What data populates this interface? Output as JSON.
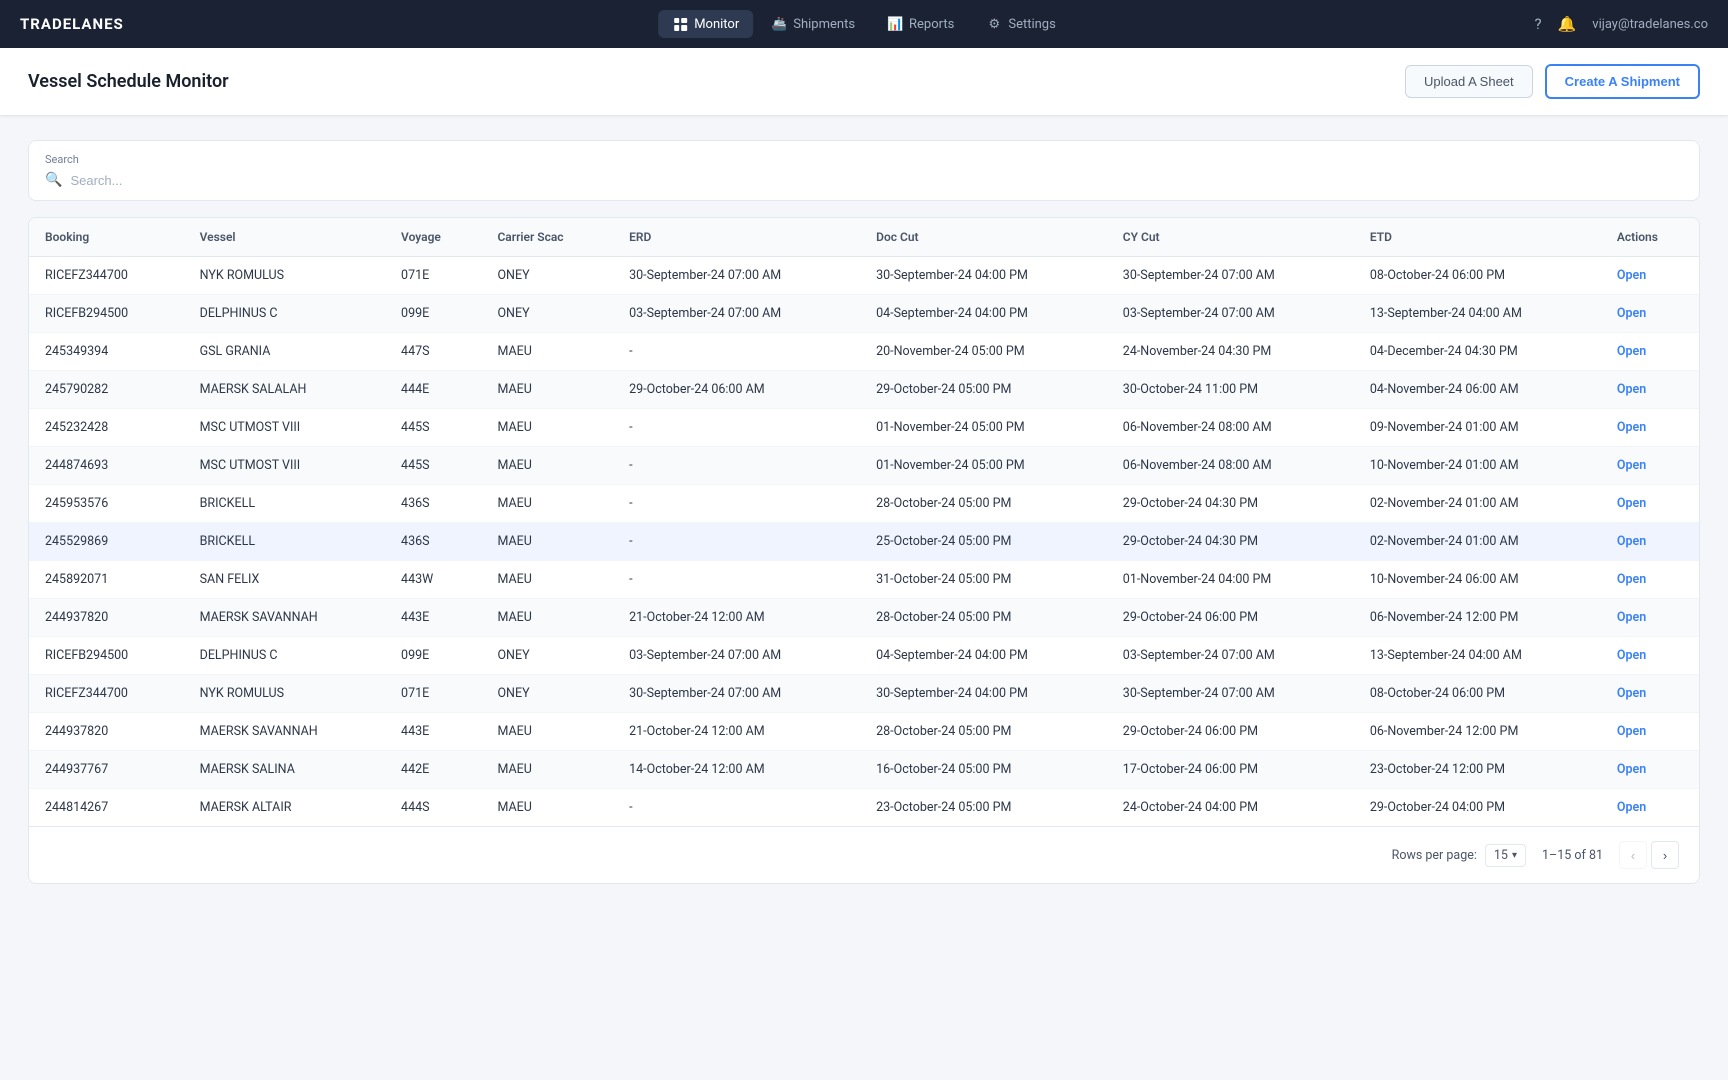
{
  "brand": "TRADELANES",
  "nav": {
    "items": [
      {
        "id": "monitor",
        "label": "Monitor",
        "active": true,
        "icon": "grid"
      },
      {
        "id": "shipments",
        "label": "Shipments",
        "active": false,
        "icon": "truck"
      },
      {
        "id": "reports",
        "label": "Reports",
        "active": false,
        "icon": "chart"
      },
      {
        "id": "settings",
        "label": "Settings",
        "active": false,
        "icon": "gear"
      }
    ],
    "user": "vijay@tradelanes.co"
  },
  "page": {
    "title": "Vessel Schedule Monitor",
    "upload_btn": "Upload A Sheet",
    "create_btn": "Create A Shipment"
  },
  "search": {
    "label": "Search",
    "placeholder": "Search..."
  },
  "table": {
    "columns": [
      "Booking",
      "Vessel",
      "Voyage",
      "Carrier Scac",
      "ERD",
      "Doc Cut",
      "CY Cut",
      "ETD",
      "Actions"
    ],
    "rows": [
      {
        "booking": "RICEFZ344700",
        "vessel": "NYK ROMULUS",
        "voyage": "071E",
        "carrier": "ONEY",
        "erd": "30-September-24 07:00 AM",
        "doc_cut": "30-September-24 04:00 PM",
        "cy_cut": "30-September-24 07:00 AM",
        "etd": "08-October-24 06:00 PM",
        "action": "Open",
        "highlighted": false
      },
      {
        "booking": "RICEFB294500",
        "vessel": "DELPHINUS C",
        "voyage": "099E",
        "carrier": "ONEY",
        "erd": "03-September-24 07:00 AM",
        "doc_cut": "04-September-24 04:00 PM",
        "cy_cut": "03-September-24 07:00 AM",
        "etd": "13-September-24 04:00 AM",
        "action": "Open",
        "highlighted": false
      },
      {
        "booking": "245349394",
        "vessel": "GSL GRANIA",
        "voyage": "447S",
        "carrier": "MAEU",
        "erd": "-",
        "doc_cut": "20-November-24 05:00 PM",
        "cy_cut": "24-November-24 04:30 PM",
        "etd": "04-December-24 04:30 PM",
        "action": "Open",
        "highlighted": false
      },
      {
        "booking": "245790282",
        "vessel": "MAERSK SALALAH",
        "voyage": "444E",
        "carrier": "MAEU",
        "erd": "29-October-24 06:00 AM",
        "doc_cut": "29-October-24 05:00 PM",
        "cy_cut": "30-October-24 11:00 PM",
        "etd": "04-November-24 06:00 AM",
        "action": "Open",
        "highlighted": false
      },
      {
        "booking": "245232428",
        "vessel": "MSC UTMOST VIII",
        "voyage": "445S",
        "carrier": "MAEU",
        "erd": "-",
        "doc_cut": "01-November-24 05:00 PM",
        "cy_cut": "06-November-24 08:00 AM",
        "etd": "09-November-24 01:00 AM",
        "action": "Open",
        "highlighted": false
      },
      {
        "booking": "244874693",
        "vessel": "MSC UTMOST VIII",
        "voyage": "445S",
        "carrier": "MAEU",
        "erd": "-",
        "doc_cut": "01-November-24 05:00 PM",
        "cy_cut": "06-November-24 08:00 AM",
        "etd": "10-November-24 01:00 AM",
        "action": "Open",
        "highlighted": false
      },
      {
        "booking": "245953576",
        "vessel": "BRICKELL",
        "voyage": "436S",
        "carrier": "MAEU",
        "erd": "-",
        "doc_cut": "28-October-24 05:00 PM",
        "cy_cut": "29-October-24 04:30 PM",
        "etd": "02-November-24 01:00 AM",
        "action": "Open",
        "highlighted": false
      },
      {
        "booking": "245529869",
        "vessel": "BRICKELL",
        "voyage": "436S",
        "carrier": "MAEU",
        "erd": "-",
        "doc_cut": "25-October-24 05:00 PM",
        "cy_cut": "29-October-24 04:30 PM",
        "etd": "02-November-24 01:00 AM",
        "action": "Open",
        "highlighted": true
      },
      {
        "booking": "245892071",
        "vessel": "SAN FELIX",
        "voyage": "443W",
        "carrier": "MAEU",
        "erd": "-",
        "doc_cut": "31-October-24 05:00 PM",
        "cy_cut": "01-November-24 04:00 PM",
        "etd": "10-November-24 06:00 AM",
        "action": "Open",
        "highlighted": false
      },
      {
        "booking": "244937820",
        "vessel": "MAERSK SAVANNAH",
        "voyage": "443E",
        "carrier": "MAEU",
        "erd": "21-October-24 12:00 AM",
        "doc_cut": "28-October-24 05:00 PM",
        "cy_cut": "29-October-24 06:00 PM",
        "etd": "06-November-24 12:00 PM",
        "action": "Open",
        "highlighted": false
      },
      {
        "booking": "RICEFB294500",
        "vessel": "DELPHINUS C",
        "voyage": "099E",
        "carrier": "ONEY",
        "erd": "03-September-24 07:00 AM",
        "doc_cut": "04-September-24 04:00 PM",
        "cy_cut": "03-September-24 07:00 AM",
        "etd": "13-September-24 04:00 AM",
        "action": "Open",
        "highlighted": false
      },
      {
        "booking": "RICEFZ344700",
        "vessel": "NYK ROMULUS",
        "voyage": "071E",
        "carrier": "ONEY",
        "erd": "30-September-24 07:00 AM",
        "doc_cut": "30-September-24 04:00 PM",
        "cy_cut": "30-September-24 07:00 AM",
        "etd": "08-October-24 06:00 PM",
        "action": "Open",
        "highlighted": false
      },
      {
        "booking": "244937820",
        "vessel": "MAERSK SAVANNAH",
        "voyage": "443E",
        "carrier": "MAEU",
        "erd": "21-October-24 12:00 AM",
        "doc_cut": "28-October-24 05:00 PM",
        "cy_cut": "29-October-24 06:00 PM",
        "etd": "06-November-24 12:00 PM",
        "action": "Open",
        "highlighted": false
      },
      {
        "booking": "244937767",
        "vessel": "MAERSK SALINA",
        "voyage": "442E",
        "carrier": "MAEU",
        "erd": "14-October-24 12:00 AM",
        "doc_cut": "16-October-24 05:00 PM",
        "cy_cut": "17-October-24 06:00 PM",
        "etd": "23-October-24 12:00 PM",
        "action": "Open",
        "highlighted": false
      },
      {
        "booking": "244814267",
        "vessel": "MAERSK ALTAIR",
        "voyage": "444S",
        "carrier": "MAEU",
        "erd": "-",
        "doc_cut": "23-October-24 05:00 PM",
        "cy_cut": "24-October-24 04:00 PM",
        "etd": "29-October-24 04:00 PM",
        "action": "Open",
        "highlighted": false
      }
    ]
  },
  "pagination": {
    "rows_per_page_label": "Rows per page:",
    "rows_per_page": "15",
    "page_info": "1–15 of 81",
    "prev_disabled": true,
    "next_disabled": false
  }
}
